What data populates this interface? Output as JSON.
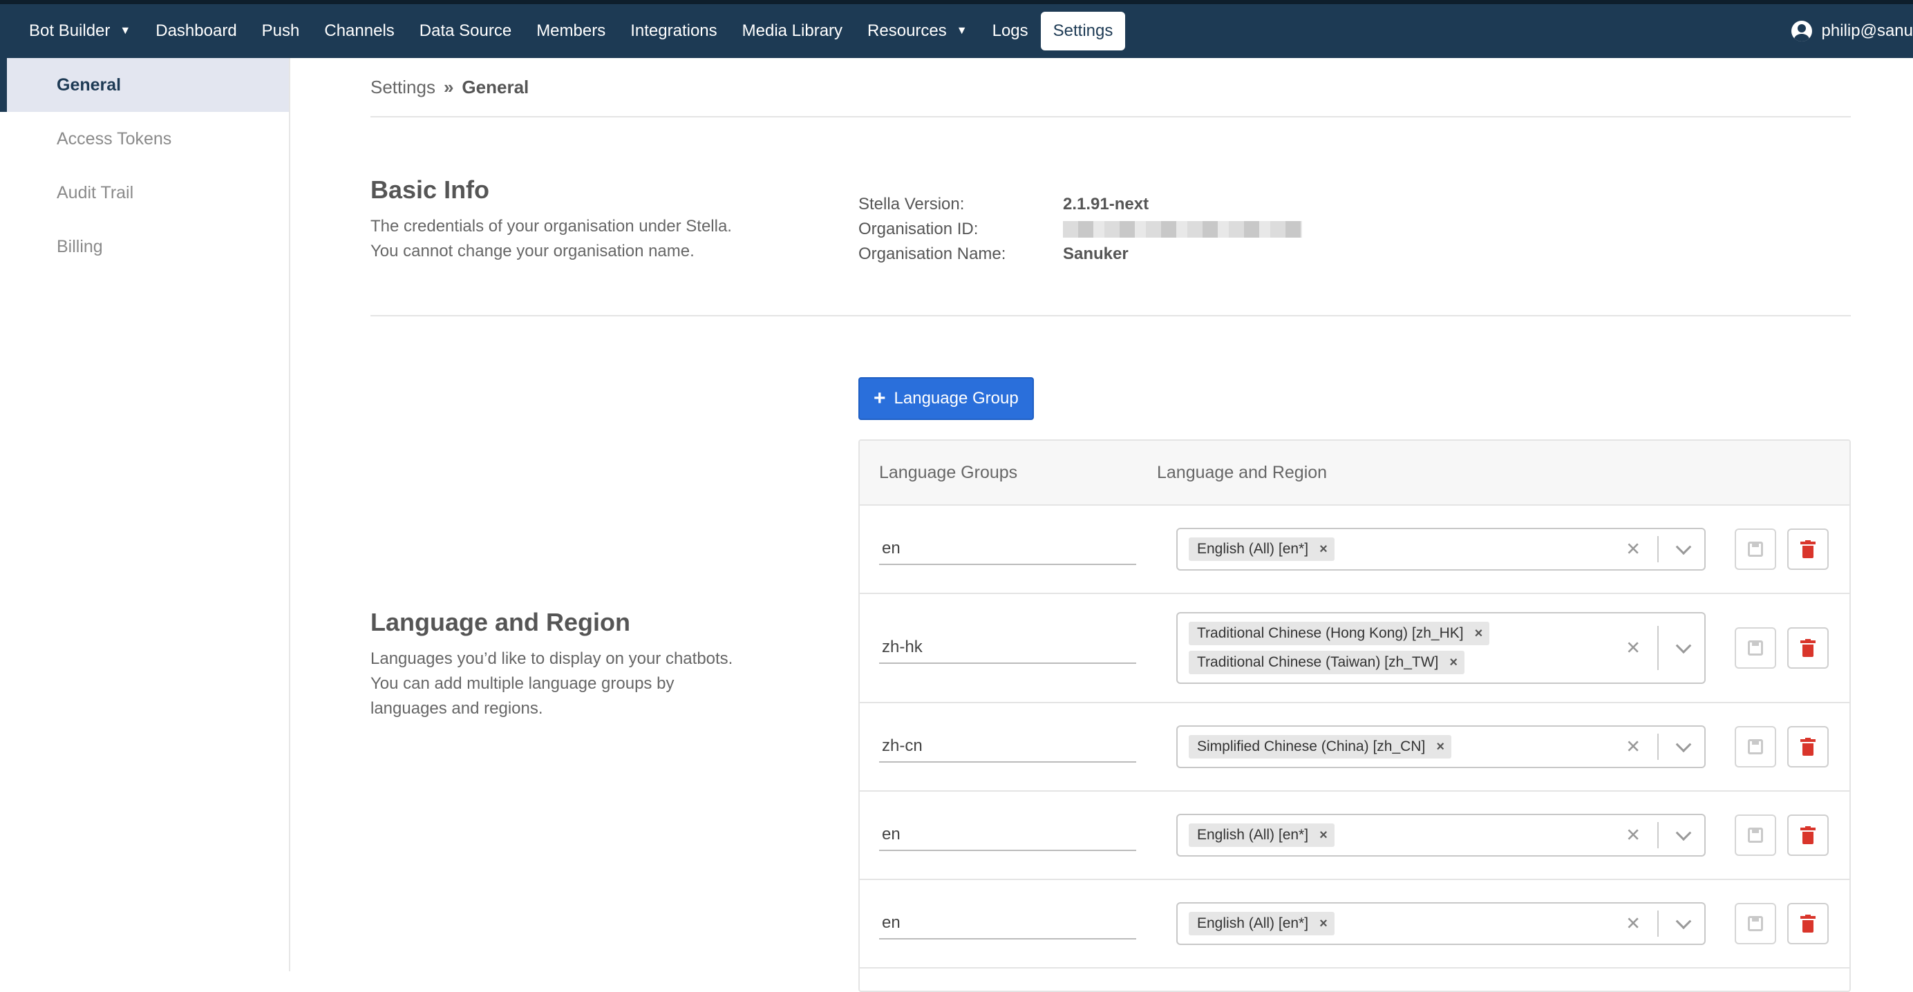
{
  "nav": {
    "items": [
      {
        "label": "Bot Builder",
        "caret": true
      },
      {
        "label": "Dashboard"
      },
      {
        "label": "Push"
      },
      {
        "label": "Channels"
      },
      {
        "label": "Data Source"
      },
      {
        "label": "Members"
      },
      {
        "label": "Integrations"
      },
      {
        "label": "Media Library"
      },
      {
        "label": "Resources",
        "caret": true
      },
      {
        "label": "Logs"
      },
      {
        "label": "Settings",
        "active": true
      }
    ],
    "user": "philip@sanu"
  },
  "sidebar": {
    "items": [
      {
        "label": "General",
        "active": true
      },
      {
        "label": "Access Tokens"
      },
      {
        "label": "Audit Trail"
      },
      {
        "label": "Billing"
      }
    ]
  },
  "breadcrumb": {
    "root": "Settings",
    "current": "General"
  },
  "basic_info": {
    "title": "Basic Info",
    "desc_line1": "The credentials of your organisation under Stella.",
    "desc_line2": "You cannot change your organisation name.",
    "version_label": "Stella Version:",
    "version_value": "2.1.91-next",
    "org_id_label": "Organisation ID:",
    "org_name_label": "Organisation Name:",
    "org_name_value": "Sanuker"
  },
  "language": {
    "title": "Language and Region",
    "desc_line1": "Languages you’d like to display on your chatbots.",
    "desc_line2": "You can add multiple language groups by",
    "desc_line3": "languages and regions.",
    "add_button": "Language Group",
    "col_groups": "Language Groups",
    "col_region": "Language and Region",
    "rows": [
      {
        "group": "en",
        "regions": [
          "English (All) [en*]"
        ]
      },
      {
        "group": "zh-hk",
        "regions": [
          "Traditional Chinese (Hong Kong) [zh_HK]",
          "Traditional Chinese (Taiwan) [zh_TW]"
        ]
      },
      {
        "group": "zh-cn",
        "regions": [
          "Simplified Chinese (China) [zh_CN]"
        ]
      },
      {
        "group": "en",
        "regions": [
          "English (All) [en*]"
        ]
      },
      {
        "group": "en",
        "regions": [
          "English (All) [en*]"
        ]
      }
    ]
  }
}
